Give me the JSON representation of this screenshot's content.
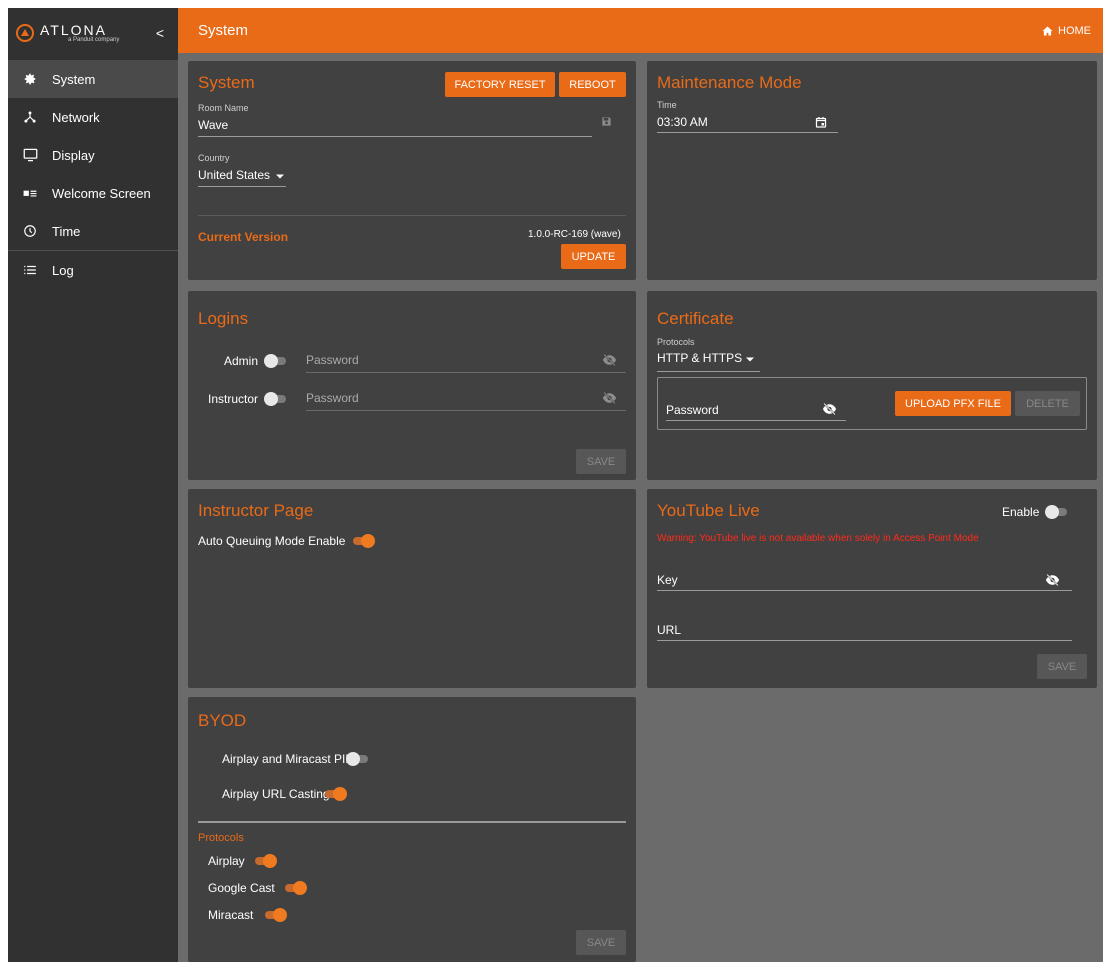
{
  "sidebar": {
    "logo": "ATLONA",
    "logo_sub": "a Panduit company",
    "collapse": "<",
    "items": [
      {
        "label": "System",
        "icon": "gear-icon"
      },
      {
        "label": "Network",
        "icon": "network-icon"
      },
      {
        "label": "Display",
        "icon": "monitor-icon"
      },
      {
        "label": "Welcome Screen",
        "icon": "welcome-screen-icon"
      },
      {
        "label": "Time",
        "icon": "clock-icon"
      },
      {
        "label": "Log",
        "icon": "list-icon"
      }
    ]
  },
  "header": {
    "title": "System",
    "home": "HOME"
  },
  "system_card": {
    "title": "System",
    "factory_reset": "FACTORY RESET",
    "reboot": "REBOOT",
    "room_name_label": "Room Name",
    "room_name_value": "Wave",
    "country_label": "Country",
    "country_value": "United States",
    "current_version_label": "Current Version",
    "current_version_value": "1.0.0-RC-169 (wave)",
    "update": "UPDATE"
  },
  "maintenance_card": {
    "title": "Maintenance Mode",
    "time_label": "Time",
    "time_value": "03:30 AM"
  },
  "logins_card": {
    "title": "Logins",
    "admin_label": "Admin",
    "admin_enabled": false,
    "admin_placeholder": "Password",
    "instructor_label": "Instructor",
    "instructor_enabled": false,
    "instructor_placeholder": "Password",
    "save": "SAVE"
  },
  "certificate_card": {
    "title": "Certificate",
    "protocols_label": "Protocols",
    "protocols_value": "HTTP & HTTPS",
    "password_placeholder": "Password",
    "upload": "UPLOAD PFX FILE",
    "delete": "DELETE"
  },
  "instructor_card": {
    "title": "Instructor Page",
    "auto_queue_label": "Auto Queuing Mode Enable",
    "auto_queue_enabled": true
  },
  "youtube_card": {
    "title": "YouTube Live",
    "enable_label": "Enable",
    "enabled": false,
    "warning": "Warning: YouTube live is not available when solely in Access Point Mode",
    "key_label": "Key",
    "url_label": "URL",
    "save": "SAVE"
  },
  "byod_card": {
    "title": "BYOD",
    "airplay_pin_label": "Airplay and Miracast PIN",
    "airplay_pin_enabled": false,
    "airplay_url_label": "Airplay URL Casting",
    "airplay_url_enabled": true,
    "protocols_heading": "Protocols",
    "airplay_label": "Airplay",
    "airplay_enabled": true,
    "google_cast_label": "Google Cast",
    "google_cast_enabled": true,
    "miracast_label": "Miracast",
    "miracast_enabled": true,
    "save": "SAVE"
  },
  "colors": {
    "accent": "#e96a17",
    "sidebar": "#313131",
    "card": "#414141",
    "background": "#6b6b6b",
    "warning": "#ff2a1a"
  }
}
